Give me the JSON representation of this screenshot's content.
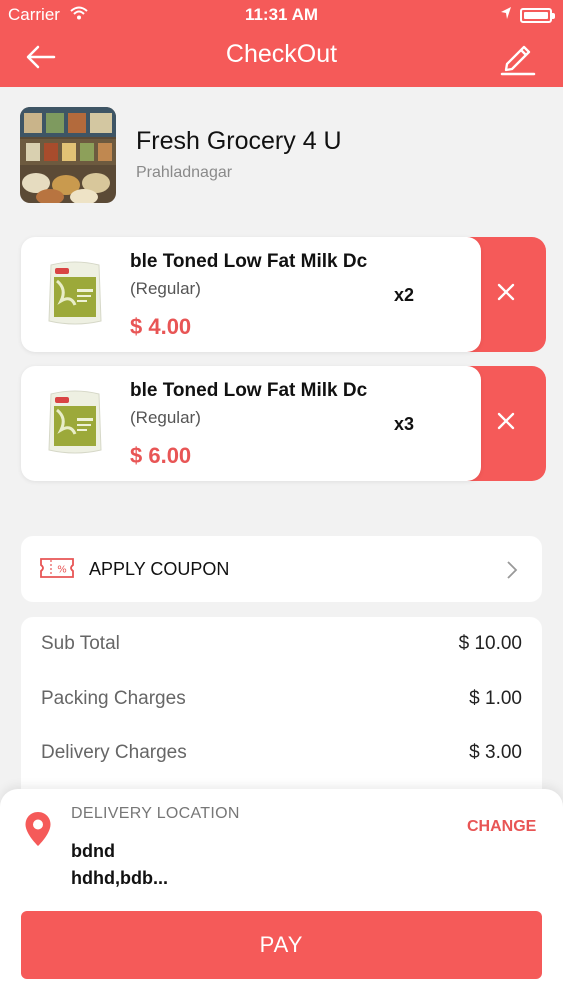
{
  "status_bar": {
    "carrier": "Carrier",
    "time": "11:31 AM"
  },
  "header": {
    "title": "CheckOut",
    "back_icon": "arrow-left-icon",
    "edit_icon": "pencil-icon"
  },
  "store": {
    "name": "Fresh Grocery 4 U",
    "area": "Prahladnagar"
  },
  "cart_items": [
    {
      "name": "ble Toned Low Fat Milk  Dc",
      "variant": "(Regular)",
      "price": "$ 4.00",
      "qty": "x2"
    },
    {
      "name": "ble Toned Low Fat Milk  Dc",
      "variant": "(Regular)",
      "price": "$ 6.00",
      "qty": "x3"
    }
  ],
  "coupon": {
    "label": "APPLY COUPON",
    "icon": "coupon-ticket-icon"
  },
  "summary": {
    "rows": [
      {
        "label": "Sub Total",
        "value": "$ 10.00"
      },
      {
        "label": "Packing Charges",
        "value": "$ 1.00"
      },
      {
        "label": "Delivery Charges",
        "value": "$ 3.00"
      }
    ]
  },
  "delivery": {
    "heading": "DELIVERY LOCATION",
    "change_label": "CHANGE",
    "address_line1": "bdnd",
    "address_line2": "hdhd,bdb..."
  },
  "pay_button": {
    "label": "PAY"
  },
  "colors": {
    "accent": "#f55a59",
    "price": "#e85555"
  }
}
